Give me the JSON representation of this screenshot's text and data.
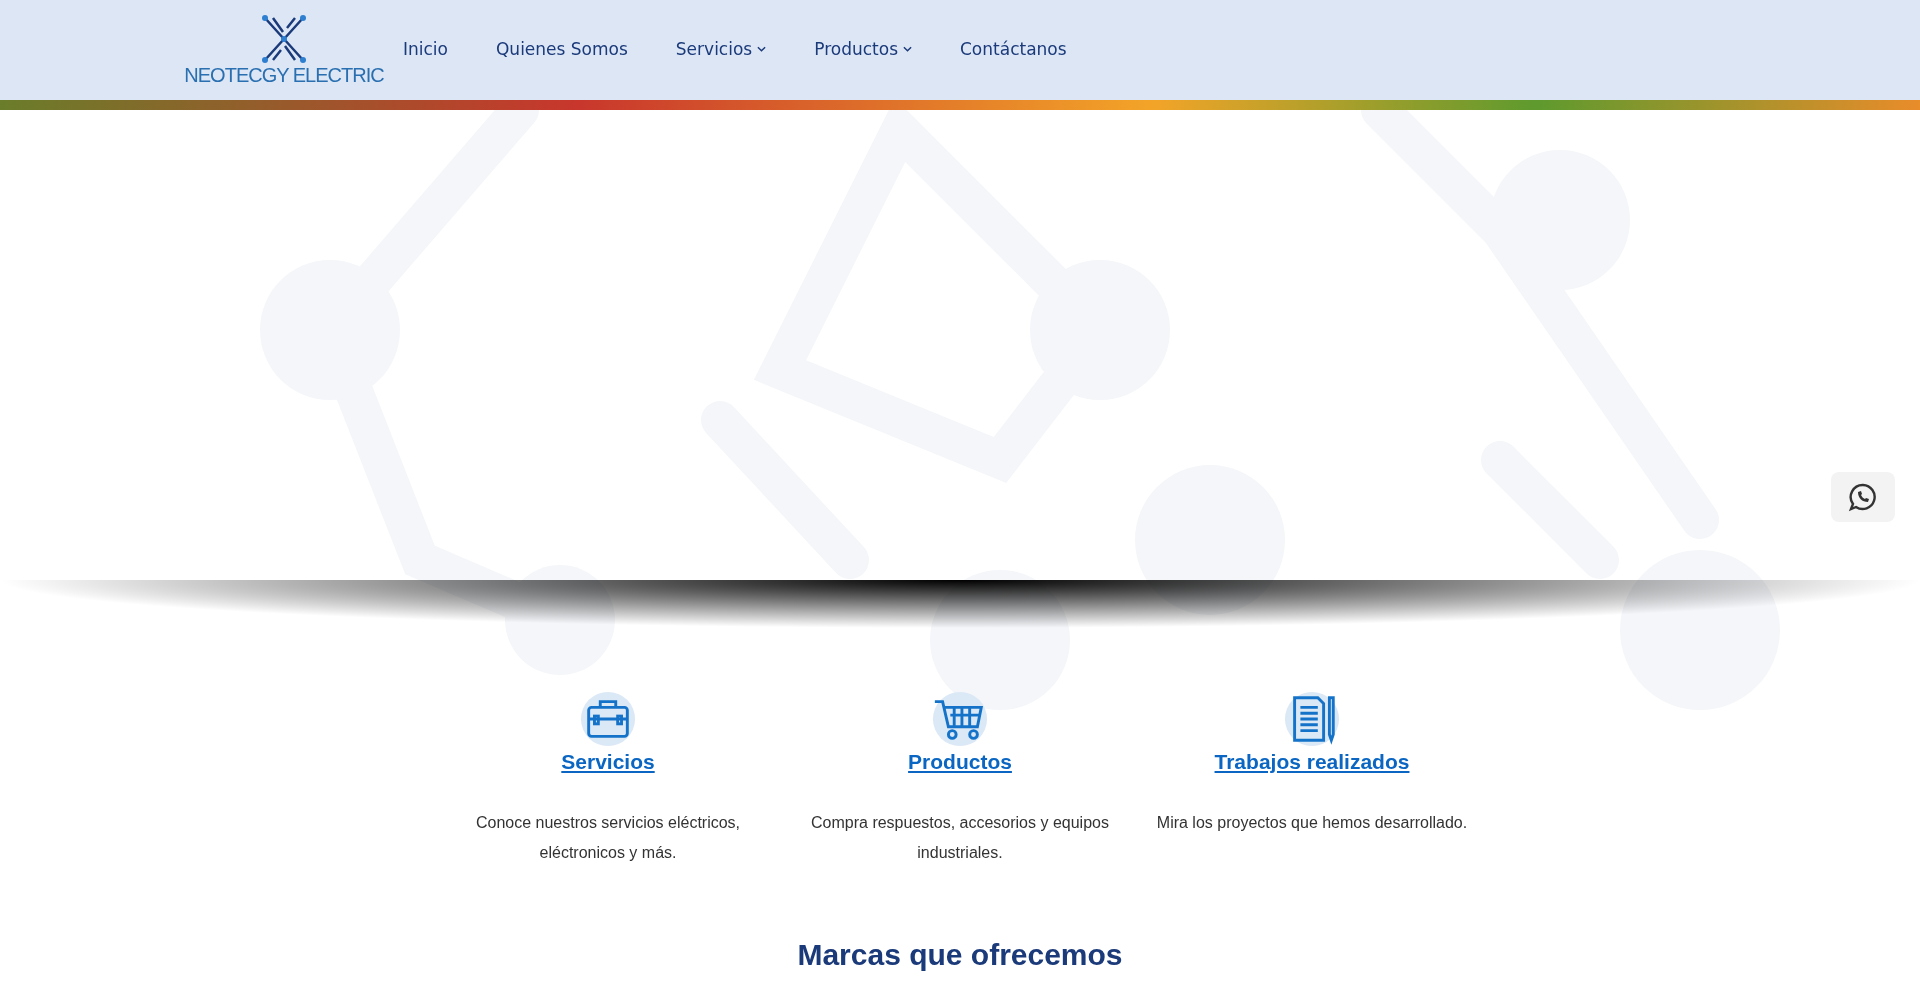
{
  "header": {
    "logo_text": "NEOTECGY ELECTRIC",
    "nav": [
      {
        "label": "Inicio",
        "dropdown": false
      },
      {
        "label": "Quienes Somos",
        "dropdown": false
      },
      {
        "label": "Servicios",
        "dropdown": true
      },
      {
        "label": "Productos",
        "dropdown": true
      },
      {
        "label": "Contáctanos",
        "dropdown": false
      }
    ]
  },
  "features": [
    {
      "kind": "briefcase",
      "title": "Servicios",
      "text": "Conoce nuestros servicios eléctricos, eléctronicos y más."
    },
    {
      "kind": "cart",
      "title": "Productos",
      "text": "Compra respuestos, accesorios y equipos industriales."
    },
    {
      "kind": "document",
      "title": "Trabajos realizados",
      "text": "Mira los proyectos que hemos desarrollado."
    }
  ],
  "brands": {
    "heading": "Marcas que ofrecemos"
  }
}
